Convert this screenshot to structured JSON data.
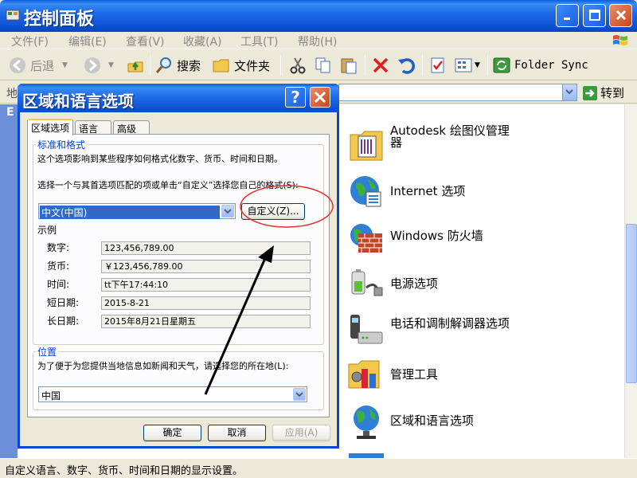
{
  "window": {
    "title": "控制面板"
  },
  "menu": [
    "文件(F)",
    "编辑(E)",
    "查看(V)",
    "收藏(A)",
    "工具(T)",
    "帮助(H)"
  ],
  "toolbar": {
    "back": "后退",
    "search": "搜索",
    "folders": "文件夹",
    "folder_sync": "Folder Sync"
  },
  "address": {
    "label": "地",
    "go": "转到"
  },
  "left_pane": {
    "label": "E"
  },
  "items": [
    {
      "label": "Autodesk 绘图仪管理器",
      "icon": "plotter-manager-icon"
    },
    {
      "label": "Internet 选项",
      "icon": "internet-options-icon"
    },
    {
      "label": "Windows 防火墙",
      "icon": "firewall-icon"
    },
    {
      "label": "电源选项",
      "icon": "power-options-icon"
    },
    {
      "label": "电话和调制解调器选项",
      "icon": "phone-modem-icon"
    },
    {
      "label": "管理工具",
      "icon": "admin-tools-icon"
    },
    {
      "label": "区域和语言选项",
      "icon": "regional-language-icon"
    }
  ],
  "status": "自定义语言、数字、货币、时间和日期的显示设置。",
  "dialog": {
    "title": "区域和语言选项",
    "help": "?",
    "tabs": [
      "区域选项",
      "语言",
      "高级"
    ],
    "standards_group": "标准和格式",
    "standards_desc": "这个选项影响到某些程序如何格式化数字、货币、时间和日期。",
    "select_prompt": "选择一个与其首选项匹配的项或单击“自定义”选择您自己的格式(S):",
    "format_value": "中文(中国)",
    "customize": "自定义(Z)...",
    "samples_label": "示例",
    "samples": [
      {
        "label": "数字:",
        "value": "123,456,789.00"
      },
      {
        "label": "货币:",
        "value": "￥123,456,789.00"
      },
      {
        "label": "时间:",
        "value": "tt下午17:44:10"
      },
      {
        "label": "短日期:",
        "value": "2015-8-21"
      },
      {
        "label": "长日期:",
        "value": "2015年8月21日星期五"
      }
    ],
    "location_group": "位置",
    "location_desc": "为了便于为您提供当地信息如新闻和天气，请选择您的所在地(L):",
    "location_value": "中国",
    "ok": "确定",
    "cancel": "取消",
    "apply": "应用(A)"
  },
  "colors": {
    "title_blue": "#0A5DDB",
    "dialog_bg": "#ECE9D8",
    "group_label": "#0046D5",
    "annotation": "#E03030"
  }
}
